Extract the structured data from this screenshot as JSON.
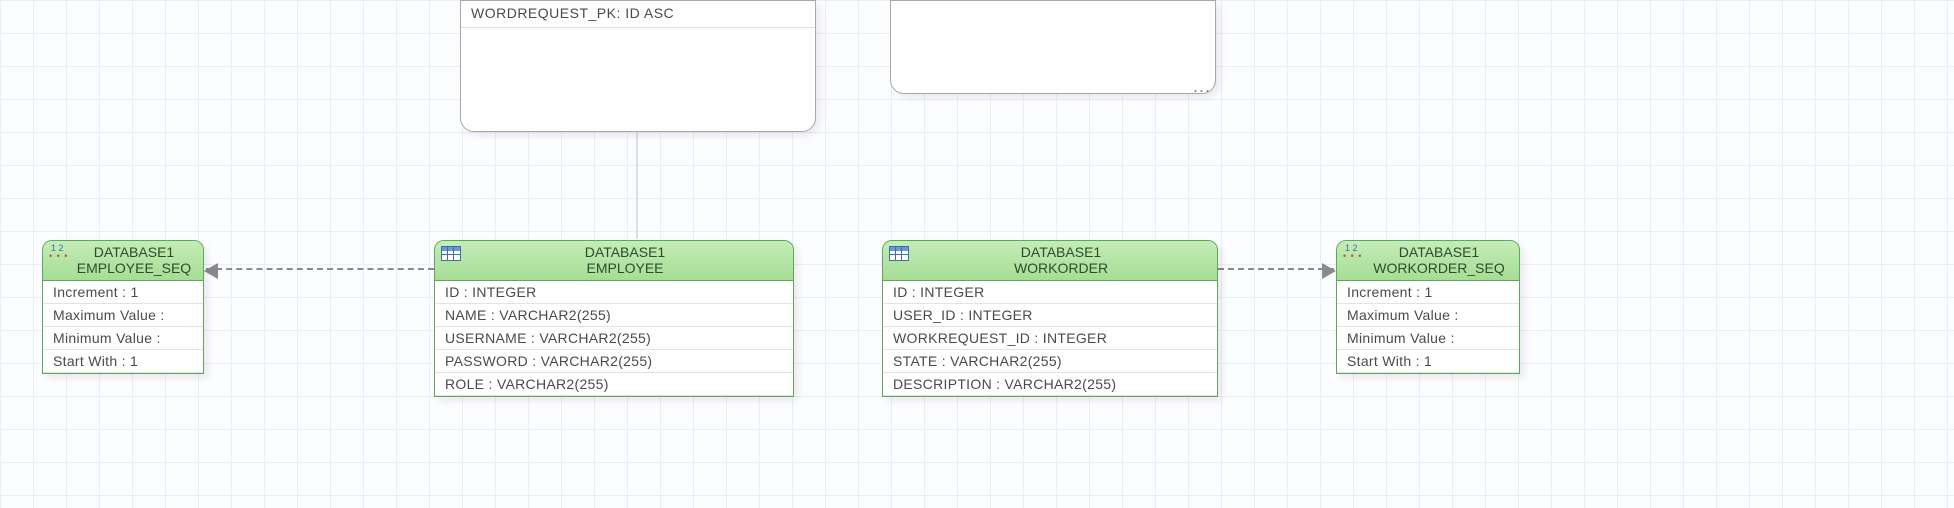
{
  "upper_boxes": {
    "left": {
      "row1": "WORDREQUEST_PK: ID ASC"
    },
    "right": {
      "ellipsis": "..."
    }
  },
  "seq_employee": {
    "schema": "DATABASE1",
    "name": "EMPLOYEE_SEQ",
    "rows": {
      "increment": "Increment : 1",
      "max": "Maximum Value :",
      "min": "Minimum Value :",
      "start": "Start With : 1"
    }
  },
  "tbl_employee": {
    "schema": "DATABASE1",
    "name": "EMPLOYEE",
    "cols": {
      "c1": "ID : INTEGER",
      "c2": "NAME : VARCHAR2(255)",
      "c3": "USERNAME : VARCHAR2(255)",
      "c4": "PASSWORD : VARCHAR2(255)",
      "c5": "ROLE : VARCHAR2(255)"
    }
  },
  "tbl_workorder": {
    "schema": "DATABASE1",
    "name": "WORKORDER",
    "cols": {
      "c1": "ID : INTEGER",
      "c2": "USER_ID : INTEGER",
      "c3": "WORKREQUEST_ID : INTEGER",
      "c4": "STATE : VARCHAR2(255)",
      "c5": "DESCRIPTION : VARCHAR2(255)"
    }
  },
  "seq_workorder": {
    "schema": "DATABASE1",
    "name": "WORKORDER_SEQ",
    "rows": {
      "increment": "Increment : 1",
      "max": "Maximum Value :",
      "min": "Minimum Value :",
      "start": "Start With : 1"
    }
  }
}
